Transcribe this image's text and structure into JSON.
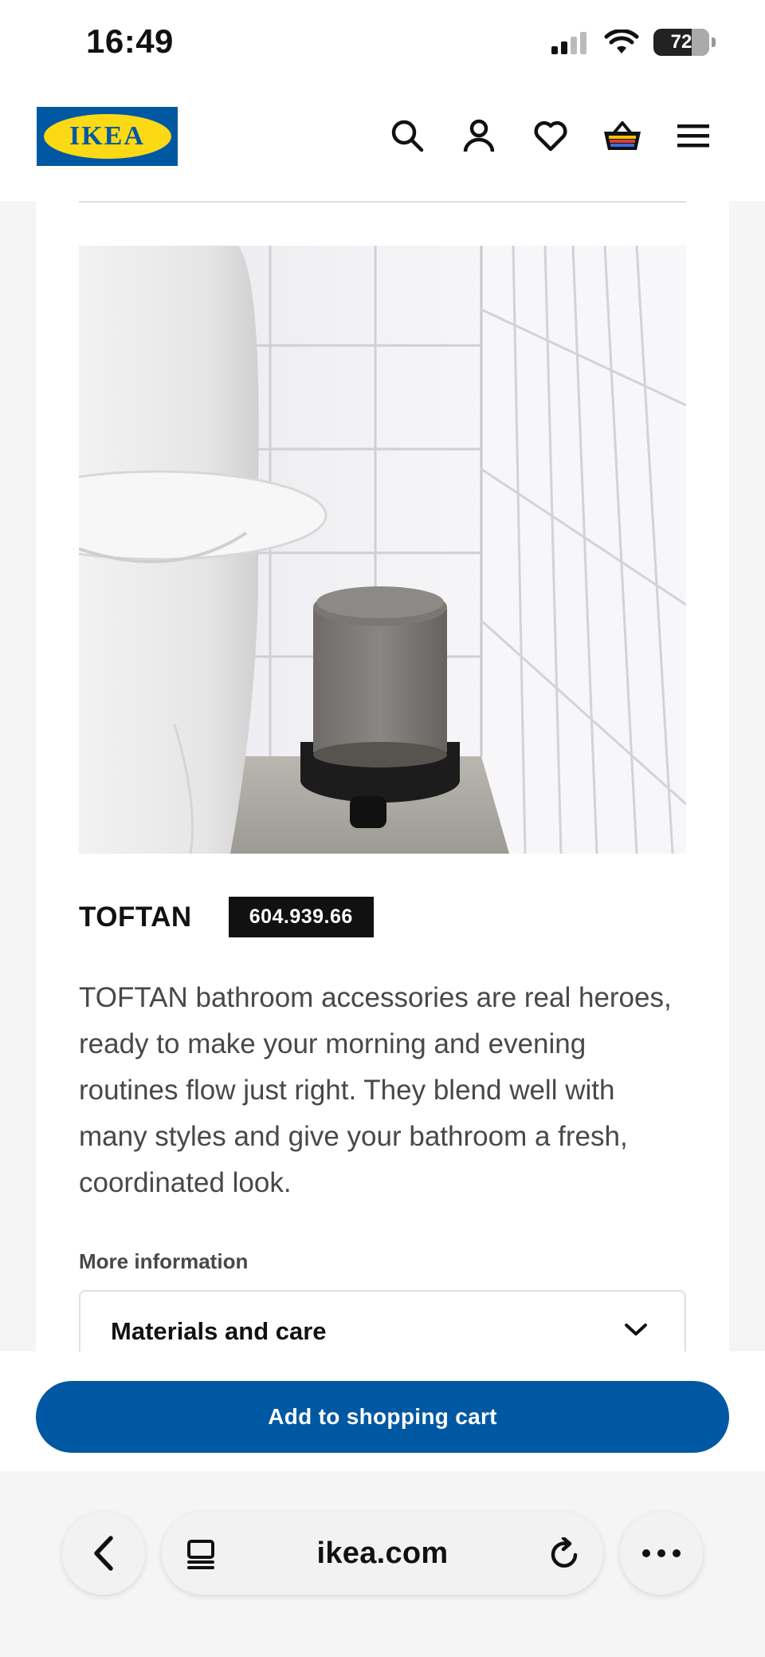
{
  "status_bar": {
    "time": "16:49",
    "battery": "72"
  },
  "header": {
    "logo_text": "IKEA",
    "icons": [
      "search-icon",
      "account-icon",
      "heart-icon",
      "cart-icon",
      "menu-icon"
    ]
  },
  "product": {
    "name": "TOFTAN",
    "article_number": "604.939.66",
    "description": "TOFTAN bathroom accessories are real heroes, ready to make your morning and evening routines flow just right. They blend well with many styles and give your bathroom a fresh, coordinated look.",
    "more_info_label": "More information",
    "accordion_title": "Materials and care"
  },
  "cart": {
    "button_label": "Add to shopping cart"
  },
  "browser": {
    "url": "ikea.com"
  },
  "colors": {
    "brand_blue": "#0058a3",
    "brand_yellow": "#fbd914"
  }
}
